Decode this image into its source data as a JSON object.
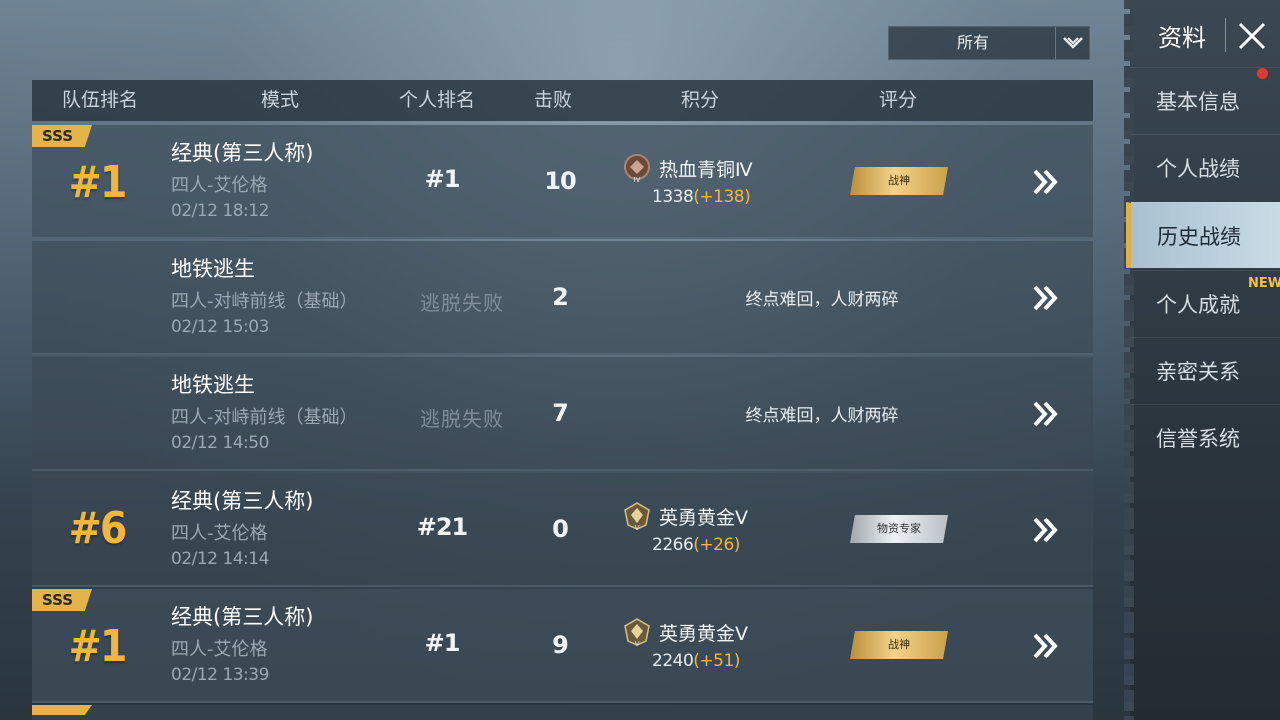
{
  "filter": {
    "value": "所有"
  },
  "table": {
    "headers": [
      "队伍排名",
      "模式",
      "个人排名",
      "击败",
      "积分",
      "评分"
    ],
    "rows": [
      {
        "tag": "SSS",
        "team_rank": "#1",
        "mode": "经典(第三人称)",
        "sub": "四人-艾伦格",
        "time": "02/12 18:12",
        "personal_rank": "#1",
        "kills": "10",
        "tier": "热血青铜Ⅳ",
        "score": "1338",
        "delta": "(+138)",
        "badge": "战神"
      },
      {
        "tag": "",
        "team_rank": "",
        "mode": "地铁逃生",
        "sub": "四人-对峙前线（基础）",
        "time": "02/12 15:03",
        "personal_rank": "逃脱失败",
        "kills": "2",
        "message": "终点难回，人财两碎"
      },
      {
        "tag": "",
        "team_rank": "",
        "mode": "地铁逃生",
        "sub": "四人-对峙前线（基础）",
        "time": "02/12 14:50",
        "personal_rank": "逃脱失败",
        "kills": "7",
        "message": "终点难回，人财两碎"
      },
      {
        "tag": "",
        "team_rank": "#6",
        "mode": "经典(第三人称)",
        "sub": "四人-艾伦格",
        "time": "02/12 14:14",
        "personal_rank": "#21",
        "kills": "0",
        "tier": "英勇黄金Ⅴ",
        "score": "2266",
        "delta": "(+26)",
        "badge": "物资专家"
      },
      {
        "tag": "SSS",
        "team_rank": "#1",
        "mode": "经典(第三人称)",
        "sub": "四人-艾伦格",
        "time": "02/12 13:39",
        "personal_rank": "#1",
        "kills": "9",
        "tier": "英勇黄金Ⅴ",
        "score": "2240",
        "delta": "(+51)",
        "badge": "战神"
      }
    ]
  },
  "sidebar": {
    "title": "资料",
    "items": [
      "基本信息",
      "个人战绩",
      "历史战绩",
      "个人成就",
      "亲密关系",
      "信誉系统"
    ],
    "active_index": 2,
    "new_tag": "NEW"
  },
  "colors": {
    "accent_gold": "#f2b63c",
    "badge_gold": "#e4b44a",
    "notification_red": "#e03a30"
  },
  "icons": [
    "chevron-down-icon",
    "close-icon",
    "double-chevron-right-icon",
    "bronze-tier-icon",
    "gold-tier-icon"
  ]
}
